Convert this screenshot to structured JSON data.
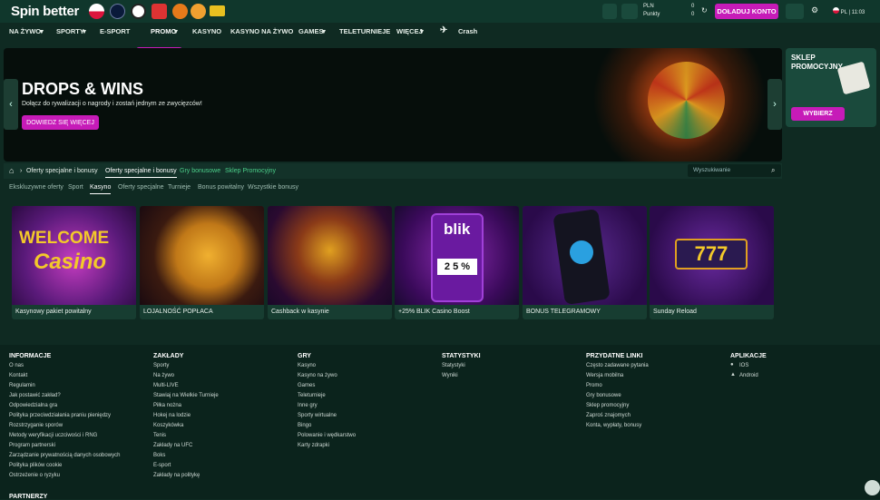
{
  "brand": {
    "logo": "Spin better"
  },
  "account": {
    "currency": "PLN",
    "balance": "0",
    "points_label": "Punkty",
    "points": "0",
    "deposit_label": "DOŁADUJ KONTO",
    "lang": "PL",
    "time": "11:03"
  },
  "nav": {
    "items": [
      "NA ŻYWO",
      "SPORTY",
      "E-SPORT",
      "PROMO",
      "KASYNO",
      "KASYNO NA ŻYWO",
      "GAMES",
      "TELETURNIEJE",
      "WIĘCEJ",
      "Crash"
    ]
  },
  "banner": {
    "title": "DROPS & WINS",
    "subtitle": "Dołącz do rywalizacji o nagrody i zostań jednym ze zwycięzców!",
    "cta": "DOWIEDZ SIĘ WIĘCEJ"
  },
  "shop": {
    "title": "SKLEP PROMOCYJNY",
    "cta": "WYBIERZ"
  },
  "crumbs": {
    "items": [
      "Oferty specjalne i bonusy",
      "Oferty specjalne i bonusy",
      "Gry bonusowe",
      "Sklep Promocyjny"
    ],
    "search_placeholder": "Wyszukiwanie"
  },
  "subtabs": [
    "Ekskluzywne oferty",
    "Sport",
    "Kasyno",
    "Oferty specjalne",
    "Turnieje",
    "Bonus powitalny",
    "Wszystkie bonusy"
  ],
  "cards": [
    "Kasynowy pakiet powitalny",
    "LOJALNOŚĆ POPŁACA",
    "Cashback w kasynie",
    "+25% BLIK Casino Boost",
    "BONUS TELEGRAMOWY",
    "Sunday Reload"
  ],
  "card_art": {
    "welcome": "WELCOME",
    "casino": "Casino",
    "blik": "blik",
    "blik_reels": "2 5 %",
    "slot": "777"
  },
  "footer": {
    "informacje": {
      "title": "INFORMACJE",
      "links": [
        "O nas",
        "Kontakt",
        "Regulamin",
        "Jak postawić zakład?",
        "Odpowiedzialna gra",
        "Polityka przeciwdziałania praniu pieniędzy",
        "Rozstrzyganie sporów",
        "Metody weryfikacji uczciwości i RNG",
        "Program partnerski",
        "Zarządzanie prywatnością danych osobowych",
        "Polityka plików cookie",
        "Ostrzeżenie o ryzyku"
      ]
    },
    "zaklady": {
      "title": "ZAKŁADY",
      "links": [
        "Sporty",
        "Na żywo",
        "Multi-LIVE",
        "Stawiaj na Wielkie Turnieje",
        "Piłka nożna",
        "Hokej na lodzie",
        "Koszykówka",
        "Tenis",
        "Zakłady na UFC",
        "Boks",
        "E-sport",
        "Zakłady na politykę"
      ]
    },
    "gry": {
      "title": "GRY",
      "links": [
        "Kasyno",
        "Kasyno na żywo",
        "Games",
        "Teleturnieje",
        "Inne gry",
        "Sporty wirtualne",
        "Bingo",
        "Polowanie i wędkarstwo",
        "Karty zdrapki"
      ]
    },
    "statystyki": {
      "title": "STATYSTYKI",
      "links": [
        "Statystyki",
        "Wyniki"
      ]
    },
    "przydatne": {
      "title": "PRZYDATNE LINKI",
      "links": [
        "Często zadawane pytania",
        "Wersja mobilna",
        "Promo",
        "Gry bonusowe",
        "Sklep promocyjny",
        "Zaproś znajomych",
        "Konta, wypłaty, bonusy"
      ]
    },
    "aplikacje": {
      "title": "APLIKACJE",
      "links": [
        "IOS",
        "Android"
      ]
    },
    "partnerzy": "PARTNERZY"
  }
}
